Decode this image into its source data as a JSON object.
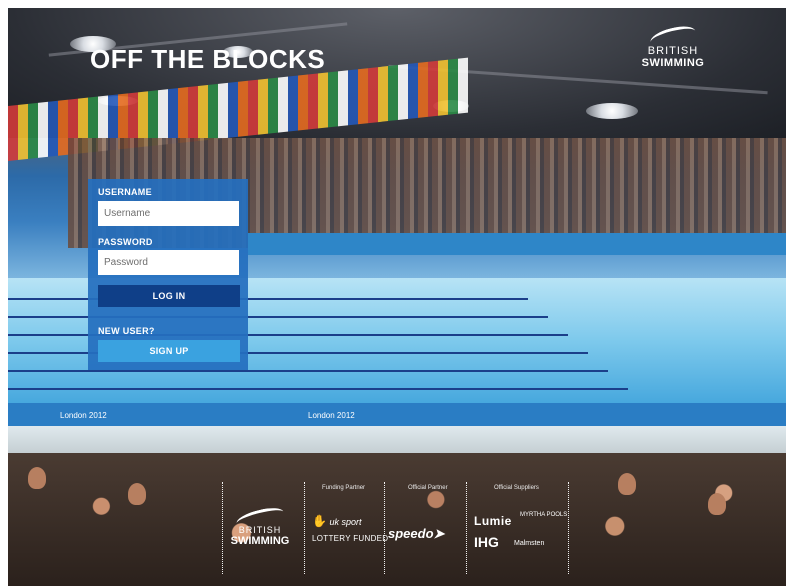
{
  "header": {
    "title": "OFF THE BLOCKS",
    "brand_line1": "BRITISH",
    "brand_line2": "SWIMMING"
  },
  "login": {
    "username_label": "USERNAME",
    "username_placeholder": "Username",
    "username_value": "",
    "password_label": "PASSWORD",
    "password_placeholder": "Password",
    "password_value": "",
    "login_button": "LOG IN",
    "new_user_label": "NEW USER?",
    "signup_button": "SIGN UP"
  },
  "background": {
    "banners": [
      "London 2012",
      "London 2012",
      "London 2012"
    ]
  },
  "sponsors": {
    "funding_caption": "Funding Partner",
    "official_caption": "Official Partner",
    "supplier_caption": "Official Suppliers",
    "british_swimming": {
      "line1": "BRITISH",
      "line2": "SWIMMING"
    },
    "uk_sport": "uk sport",
    "lottery": "LOTTERY FUNDED",
    "speedo": "speedo",
    "lumie": "Lumie",
    "myrtha": "MYRTHA POOLS",
    "ihg": "IHG",
    "malmsten": "Malmsten"
  },
  "colors": {
    "panel": "#256fbe",
    "login_button": "#0f3f88",
    "signup_button": "#3aa2e0"
  }
}
